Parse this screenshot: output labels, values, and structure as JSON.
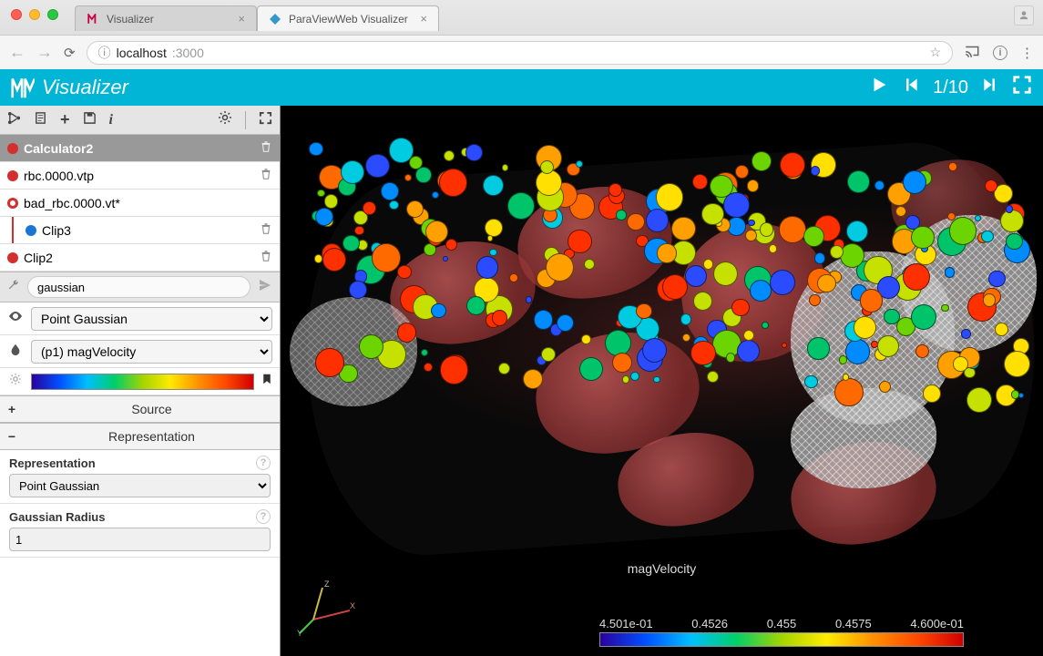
{
  "browser": {
    "tabs": [
      {
        "title": "Visualizer",
        "active": false
      },
      {
        "title": "ParaViewWeb Visualizer",
        "active": true
      }
    ],
    "url_host": "localhost",
    "url_port": ":3000"
  },
  "app": {
    "title": "Visualizer",
    "frame_current": "1",
    "frame_sep": "/",
    "frame_total": "10"
  },
  "pipeline": {
    "items": [
      {
        "name": "Calculator2",
        "selected": true,
        "dot": "red",
        "indent": 0
      },
      {
        "name": "rbc.0000.vtp",
        "selected": false,
        "dot": "red",
        "indent": 0
      },
      {
        "name": "bad_rbc.0000.vt*",
        "selected": false,
        "dot": "red-o",
        "indent": 0
      },
      {
        "name": "Clip3",
        "selected": false,
        "dot": "blue",
        "indent": 1
      },
      {
        "name": "Clip2",
        "selected": false,
        "dot": "red",
        "indent": 0
      }
    ]
  },
  "filter": {
    "value": "gaussian"
  },
  "representation_select": {
    "value": "Point Gaussian"
  },
  "colorby_select": {
    "value": "(p1) magVelocity"
  },
  "sections": {
    "source": {
      "label": "Source",
      "expanded": false
    },
    "representation": {
      "label": "Representation",
      "expanded": true
    }
  },
  "props": {
    "representation": {
      "label": "Representation",
      "value": "Point Gaussian"
    },
    "gaussian_radius": {
      "label": "Gaussian Radius",
      "value": "1"
    }
  },
  "scalarbar": {
    "title": "magVelocity",
    "ticks": [
      "4.501e-01",
      "0.4526",
      "0.455",
      "0.4575",
      "4.600e-01"
    ]
  }
}
